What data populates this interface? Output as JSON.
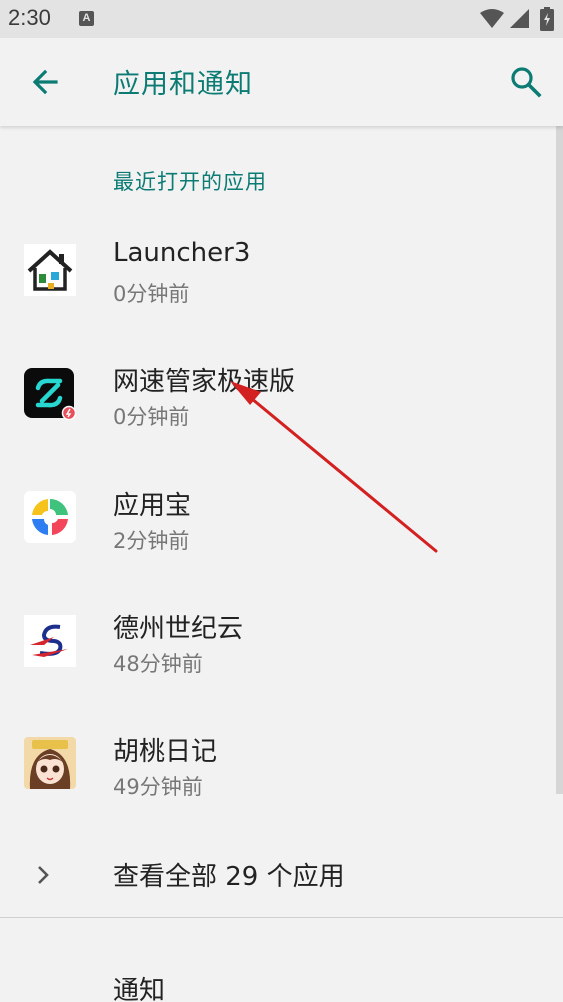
{
  "status_bar": {
    "time": "2:30",
    "notification_icon": "A",
    "icons": [
      "wifi-icon",
      "signal-icon",
      "battery-icon"
    ]
  },
  "app_bar": {
    "title": "应用和通知",
    "back_icon": "arrow-left-icon",
    "search_icon": "search-icon"
  },
  "recent_apps": {
    "header": "最近打开的应用",
    "items": [
      {
        "name": "Launcher3",
        "time": "0分钟前",
        "icon": "launcher-house-icon"
      },
      {
        "name": "网速管家极速版",
        "time": "0分钟前",
        "icon": "speed-manager-icon"
      },
      {
        "name": "应用宝",
        "time": "2分钟前",
        "icon": "yingyongbao-icon"
      },
      {
        "name": "德州世纪云",
        "time": "48分钟前",
        "icon": "dezhou-cloud-icon"
      },
      {
        "name": "胡桃日记",
        "time": "49分钟前",
        "icon": "hutao-diary-icon"
      }
    ],
    "see_all": "查看全部 29 个应用"
  },
  "notifications": {
    "label": "通知"
  },
  "colors": {
    "accent": "#0b7b74",
    "background": "#f2f2f2",
    "status_bar": "#e3e3e3",
    "annotation_arrow": "#d32020"
  }
}
